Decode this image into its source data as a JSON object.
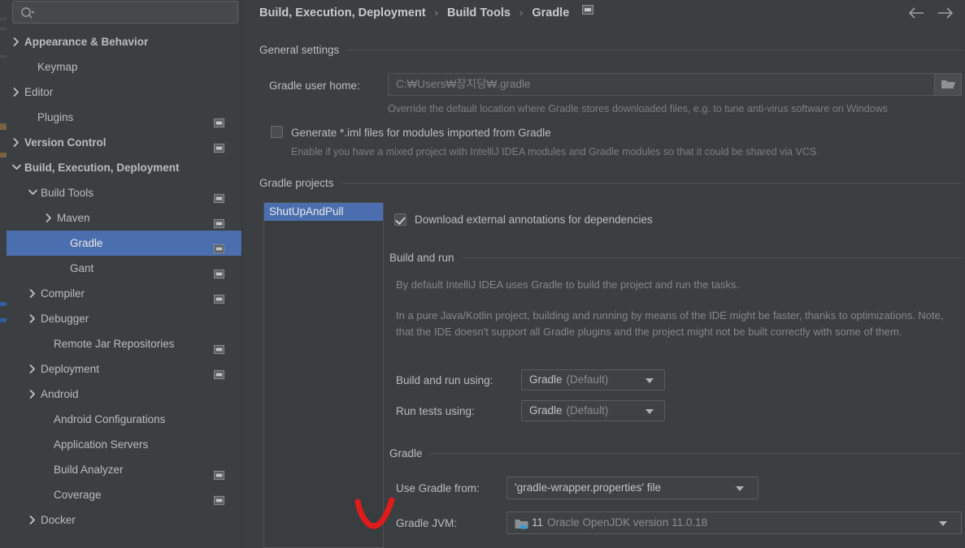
{
  "app": {
    "theme_bg": "#3c3f41",
    "accent_selection": "#4b6eaf",
    "annotation_color": "#e01b1b"
  },
  "search": {
    "placeholder": "",
    "value": "",
    "icon": "search-icon"
  },
  "sidebar": {
    "items": [
      {
        "label": "Appearance & Behavior",
        "indent": 22,
        "chevron": "right",
        "bold": true,
        "badge": false,
        "selected": false
      },
      {
        "label": "Keymap",
        "indent": 38,
        "chevron": "none",
        "bold": false,
        "badge": false,
        "selected": false
      },
      {
        "label": "Editor",
        "indent": 22,
        "chevron": "right",
        "bold": false,
        "badge": false,
        "selected": false
      },
      {
        "label": "Plugins",
        "indent": 38,
        "chevron": "none",
        "bold": false,
        "badge": true,
        "selected": false
      },
      {
        "label": "Version Control",
        "indent": 22,
        "chevron": "right",
        "bold": true,
        "badge": true,
        "selected": false
      },
      {
        "label": "Build, Execution, Deployment",
        "indent": 22,
        "chevron": "down",
        "bold": true,
        "badge": false,
        "selected": false
      },
      {
        "label": "Build Tools",
        "indent": 42,
        "chevron": "down",
        "bold": false,
        "badge": true,
        "selected": false
      },
      {
        "label": "Maven",
        "indent": 62,
        "chevron": "right",
        "bold": false,
        "badge": true,
        "selected": false
      },
      {
        "label": "Gradle",
        "indent": 78,
        "chevron": "none",
        "bold": false,
        "badge": true,
        "selected": true
      },
      {
        "label": "Gant",
        "indent": 78,
        "chevron": "none",
        "bold": false,
        "badge": true,
        "selected": false
      },
      {
        "label": "Compiler",
        "indent": 42,
        "chevron": "right",
        "bold": false,
        "badge": true,
        "selected": false
      },
      {
        "label": "Debugger",
        "indent": 42,
        "chevron": "right",
        "bold": false,
        "badge": false,
        "selected": false
      },
      {
        "label": "Remote Jar Repositories",
        "indent": 58,
        "chevron": "none",
        "bold": false,
        "badge": true,
        "selected": false
      },
      {
        "label": "Deployment",
        "indent": 42,
        "chevron": "right",
        "bold": false,
        "badge": true,
        "selected": false
      },
      {
        "label": "Android",
        "indent": 42,
        "chevron": "right",
        "bold": false,
        "badge": false,
        "selected": false
      },
      {
        "label": "Android Configurations",
        "indent": 58,
        "chevron": "none",
        "bold": false,
        "badge": false,
        "selected": false
      },
      {
        "label": "Application Servers",
        "indent": 58,
        "chevron": "none",
        "bold": false,
        "badge": false,
        "selected": false
      },
      {
        "label": "Build Analyzer",
        "indent": 58,
        "chevron": "none",
        "bold": false,
        "badge": true,
        "selected": false
      },
      {
        "label": "Coverage",
        "indent": 58,
        "chevron": "none",
        "bold": false,
        "badge": true,
        "selected": false
      },
      {
        "label": "Docker",
        "indent": 42,
        "chevron": "right",
        "bold": false,
        "badge": false,
        "selected": false
      }
    ]
  },
  "header": {
    "breadcrumb": [
      "Build, Execution, Deployment",
      "Build Tools",
      "Gradle"
    ],
    "separator": "›",
    "scope_badge": "project-scope-icon",
    "back": "back-arrow-icon",
    "forward": "forward-arrow-icon"
  },
  "general_settings": {
    "group_title": "General settings",
    "user_home_label": "Gradle user home:",
    "user_home_value": "C:₩Users₩장지담₩.gradle",
    "user_home_hint": "Override the default location where Gradle stores downloaded files, e.g. to tune anti-virus software on Windows",
    "browse_icon": "folder-icon",
    "iml_checkbox_label": "Generate *.iml files for modules imported from Gradle",
    "iml_checked": false,
    "iml_hint": "Enable if you have a mixed project with IntelliJ IDEA modules and Gradle modules so that it could be shared via VCS"
  },
  "gradle_projects": {
    "group_title": "Gradle projects",
    "projects": [
      "ShutUpAndPull"
    ],
    "selected_project": "ShutUpAndPull",
    "download_annotations_label": "Download external annotations for dependencies",
    "download_annotations_checked": true
  },
  "build_and_run": {
    "group_title": "Build and run",
    "paragraph_1": "By default IntelliJ IDEA uses Gradle to build the project and run the tasks.",
    "paragraph_2": "In a pure Java/Kotlin project, building and running by means of the IDE might be faster, thanks to optimizations. Note, that the IDE doesn't support all Gradle plugins and the project might not be built correctly with some of them.",
    "build_using_label": "Build and run using:",
    "build_using_value": "Gradle",
    "build_using_suffix": "(Default)",
    "tests_using_label": "Run tests using:",
    "tests_using_value": "Gradle",
    "tests_using_suffix": "(Default)"
  },
  "gradle_section": {
    "group_title": "Gradle",
    "use_gradle_from_label": "Use Gradle from:",
    "use_gradle_from_value": "'gradle-wrapper.properties' file",
    "jvm_label": "Gradle JVM:",
    "jvm_icon": "jdk-folder-icon",
    "jvm_version": "11",
    "jvm_value": "Oracle OpenJDK version 11.0.18"
  },
  "annotation": {
    "mark": "red-v-check"
  }
}
